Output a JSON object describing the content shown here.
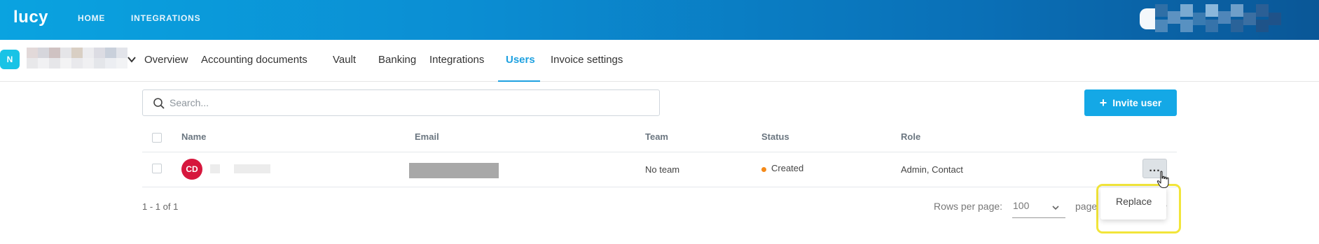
{
  "app": {
    "logo": "lucy",
    "nav": [
      "HOME",
      "INTEGRATIONS"
    ]
  },
  "org": {
    "avatar_initial": "N"
  },
  "tabs": [
    {
      "label": "Overview"
    },
    {
      "label": "Accounting documents"
    },
    {
      "label": "Vault"
    },
    {
      "label": "Banking"
    },
    {
      "label": "Integrations"
    },
    {
      "label": "Users",
      "active": true
    },
    {
      "label": "Invoice settings"
    }
  ],
  "search": {
    "placeholder": "Search..."
  },
  "invite_button": {
    "icon": "+",
    "label": "Invite user"
  },
  "table": {
    "columns": [
      "Name",
      "Email",
      "Team",
      "Status",
      "Role"
    ],
    "rows": [
      {
        "initials": "CD",
        "team": "No team",
        "status": "Created",
        "role": "Admin, Contact",
        "menu_icon": "..."
      }
    ]
  },
  "pagination": {
    "count": "1 - 1 of 1",
    "rows_per_page_label": "Rows per page:",
    "rows_per_page_value": "100",
    "page_label": "page",
    "next_icon": ">"
  },
  "context_menu": {
    "items": [
      "Replace"
    ]
  },
  "colors": {
    "accent": "#1ea1e0",
    "invite_button": "#14a8e6",
    "avatar": "#d6173d",
    "status_created": "#f48a19",
    "highlight": "#f2e53a"
  }
}
